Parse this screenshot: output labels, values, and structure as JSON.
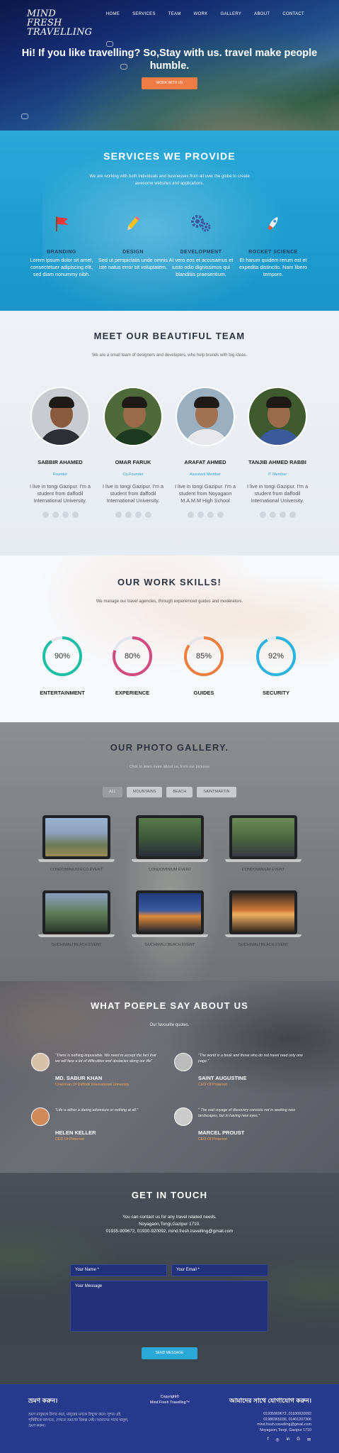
{
  "hero": {
    "logo": "MIND FRESH TRAVELLING",
    "nav": [
      "HOME",
      "SERVICES",
      "TEAM",
      "WORK",
      "GALLERY",
      "ABOUT",
      "CONTACT"
    ],
    "title": "Hi! If you like travelling? So,Stay with us. travel make people humble.",
    "button": "WORK WITH US"
  },
  "services": {
    "title": "SERVICES WE PROVIDE",
    "subtitle": "We are working with both individuals and businesses from all over the globe to create awesome websites and applications.",
    "items": [
      {
        "icon": "flag-icon",
        "name": "BRANDING",
        "desc": "Lorem ipsum dolor sit amet, consectetuer adipiscing elit, sed diam nonummy nibh."
      },
      {
        "icon": "pencil-icon",
        "name": "DESIGN",
        "desc": "Sed ut perspiciatis unde omnis iste natus error sit voluptatem."
      },
      {
        "icon": "gears-icon",
        "name": "DEVELOPMENT",
        "desc": "At vero eos et accusamus et iusto odio dignissimos qui blanditiis praesentium."
      },
      {
        "icon": "rocket-icon",
        "name": "ROCKET SCIENCE",
        "desc": "Et harum quidem rerum est et expedita distinctio. Nam libero tempore."
      }
    ]
  },
  "team": {
    "title": "MEET OUR BEAUTIFUL TEAM",
    "subtitle": "We are a small team of designers and developers, who help brands with big ideas.",
    "members": [
      {
        "name": "SABBIR AHAMED",
        "role": "Founder",
        "desc": "I live in tongi Gazipur. I'm a student from daffodil International University."
      },
      {
        "name": "OMAR FARUK",
        "role": "Co-Founder",
        "desc": "I live in tongi Gazipur. I'm a student from daffodil International University."
      },
      {
        "name": "ARAFAT AHMED",
        "role": "Assistant Member",
        "desc": "I live in tongi Gazipur. I'm a student from Noyagaon M.A.M.M High School"
      },
      {
        "name": "TANJIB AHMED RABBI",
        "role": "IT Member",
        "desc": "I live in tongi Gazipur. I'm a student from daffodil International University."
      }
    ]
  },
  "skills": {
    "title": "OUR WORK SKILLS!",
    "subtitle": "We manage our travel agencies, through experienced guides and moderators.",
    "items": [
      {
        "name": "ENTERTAINMENT",
        "label": "90%",
        "value": 0.9,
        "color": "#1fbfa6"
      },
      {
        "name": "EXPERIENCE",
        "label": "80%",
        "value": 0.8,
        "color": "#d24b7e"
      },
      {
        "name": "GUIDES",
        "label": "85%",
        "value": 0.85,
        "color": "#ec7f3f"
      },
      {
        "name": "SECURITY",
        "label": "92%",
        "value": 0.92,
        "color": "#2cb3df"
      }
    ]
  },
  "gallery": {
    "title": "OUR PHOTO GALLERY.",
    "subtitle": "Click to learn more about us, from our pictures",
    "filters": [
      "ALL",
      "MOUNTAINS",
      "BEACH",
      "SAINTMARTIN"
    ],
    "items": [
      {
        "caption": "CONDOMINIUM ECO EVENT"
      },
      {
        "caption": "CONDOMINIUM EVENT"
      },
      {
        "caption": "CONDOMINIUM EVENT"
      },
      {
        "caption": "GUCHIMALI BEACH EVENT"
      },
      {
        "caption": "GUCHIMALI BEACH EVENT"
      },
      {
        "caption": "GUCHIMALI BEACH EVENT"
      }
    ]
  },
  "testimonials": {
    "title": "WHAT POEPLE SAY ABOUT US",
    "subtitle": "Our favourite quotes.",
    "items": [
      {
        "quote": "\"There is nothing impossible. We need to accept the fact that we will face a lot of difficulties and obstacles along our life\"",
        "name": "MD. SABUR KHAN",
        "role": "Chairman Of Daffodil International University"
      },
      {
        "quote": "\"The world is a book and those who do not travel read only one page.\"",
        "name": "SAINT AUGUSTINE",
        "role": "CEO Of Pinterest"
      },
      {
        "quote": "\"Life is either a daring adventure or nothing at all.\"",
        "name": "HELEN KELLER",
        "role": "CEO Of Pinterest"
      },
      {
        "quote": "\" The real voyage of discovery consists not in seeking new landscapes, but in having new eyes.\"",
        "name": "MARCEL PROUST",
        "role": "CEO Of Pinterest"
      }
    ]
  },
  "contact": {
    "title": "GET IN TOUCH",
    "line1": "You can contact us for any travel related needs.",
    "line2": "Noyagaon,Tongi,Gazipur 1710.",
    "line3": "01935-909672, 01930-920092, mind.fresh.travelling@gmail.com",
    "name_placeholder": "Your Name *",
    "email_placeholder": "Your Email *",
    "message_placeholder": "Your Message",
    "button": "SEND MESSAGE"
  },
  "footer": {
    "left_title": "ভ্রমণ করুন।",
    "left_text": "ভ্রমণ মানুষকে উদার করে, মানুষের মনকে উন্মুক্ত করে। সুন্দর এই পৃথিবীকে জানতে, দেখতে ভ্রমণের বিকল্প নেই। আমাদের সাথে থাকুন, ভ্রমণ করুন।",
    "copyright": "Copyright©",
    "brand": "Mind Fresh Travelling™",
    "right_title": "আমাদের সাথে যোগাযোগ করুন।",
    "phone1": "01935909672 ,01930920092",
    "phone2": "01986965036, 01401207306",
    "email": "mind.fresh.travelling@gmail.com",
    "address": "Noyagaon,Tongi, Gazipur 1710",
    "icons": [
      "facebook-icon",
      "instagram-icon",
      "linkedin-icon",
      "google-icon",
      "mail-icon"
    ]
  }
}
